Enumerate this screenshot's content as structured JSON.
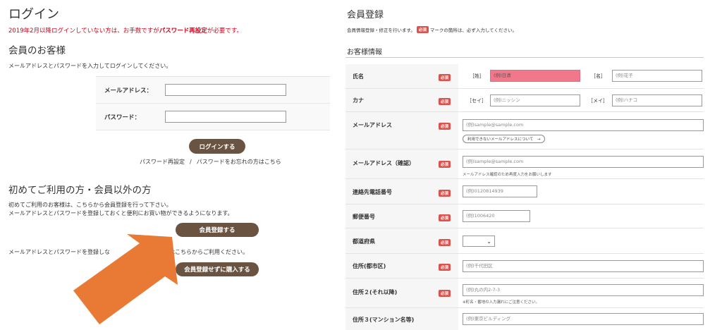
{
  "login": {
    "title": "ログイン",
    "notice_pre": "2019年2月以降ログインしていない方は、お手数ですが",
    "notice_bold": "パスワード再設定",
    "notice_post": "が必要です。",
    "member_heading": "会員のお客様",
    "description": "メールアドレスとパスワードを入力してログインしてください。",
    "email_label": "メールアドレス：",
    "password_label": "パスワード：",
    "login_button": "ログインする",
    "reset_link": "パスワード再設定",
    "separator": "/",
    "forgot_link": "パスワードをお忘れの方はこちら"
  },
  "first_time": {
    "heading": "初めてご利用の方・会員以外の方",
    "desc1": "初めてご利用のお客様は、こちらから会員登録を行って下さい。",
    "desc2": "メールアドレスとパスワードを登録しておくと便利にお買い物ができるようになります。",
    "register_button": "会員登録する",
    "guest_desc_a": "メールアドレスとパスワードを登録しな",
    "guest_desc_b": "方はこちらからご利用ください。",
    "guest_button": "会員登録せずに購入する"
  },
  "colors": {
    "accent_brown": "#6a5340",
    "required_red": "#d9534f",
    "notice_red": "#d0021b",
    "arrow_orange": "#e87a35",
    "highlight_pink": "#f0788a"
  },
  "registration": {
    "title": "会員登録",
    "desc_pre": "会員情報登録・修正を行います。",
    "desc_post": "マークの箇所は、必ず入力してください。",
    "required_badge": "必須",
    "section_title": "お客様情報",
    "name": {
      "label": "氏名",
      "sei_bracket": "［姓］",
      "sei_placeholder": "(例)日清",
      "mei_bracket": "［名］",
      "mei_placeholder": "(例)花子"
    },
    "kana": {
      "label": "カナ",
      "sei_bracket": "［セイ］",
      "sei_placeholder": "(例)ニッシン",
      "mei_bracket": "［メイ］",
      "mei_placeholder": "(例)ハナコ"
    },
    "email": {
      "label": "メールアドレス",
      "placeholder": "(例)sample@sample.com",
      "pill": "利用できないメールアドレスについて　→"
    },
    "email_confirm": {
      "label": "メールアドレス（確認）",
      "placeholder": "(例)sample@sample.com",
      "hint": "メールアドレス確認のため再度入力をお願いします"
    },
    "phone": {
      "label": "連絡先電話番号",
      "placeholder": "(例)0120814939"
    },
    "postal": {
      "label": "郵便番号",
      "placeholder": "(例)1006420"
    },
    "prefecture": {
      "label": "都道府県",
      "selected": ""
    },
    "address1": {
      "label": "住所(都市区)",
      "placeholder": "(例)千代田区"
    },
    "address2": {
      "label": "住所２(それ以降)",
      "placeholder": "(例)丸の内2-7-3",
      "hint": "※町名・番地の入力漏れにご注意ください。"
    },
    "address3": {
      "label": "住所３(マンション名等)",
      "placeholder": "(例)東京ビルディング"
    }
  }
}
